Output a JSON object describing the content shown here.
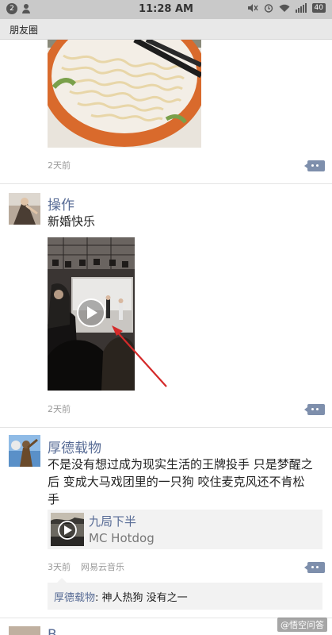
{
  "status_bar": {
    "notif_count": "2",
    "time": "11:28 AM",
    "battery": "40"
  },
  "header": {
    "title": "朋友圈"
  },
  "posts": [
    {
      "timestamp": "2天前"
    },
    {
      "name": "操作",
      "text": "新婚快乐",
      "timestamp": "2天前"
    },
    {
      "name": "厚德载物",
      "text_lines": [
        "不是没有想过成为现实生活的王牌投手 只是梦醒之",
        "后 变成大马戏团里的一只狗 咬住麦克风还不肯松",
        "手"
      ],
      "music": {
        "title": "九局下半",
        "artist": "MC Hotdog"
      },
      "timestamp": "3天前",
      "source": "网易云音乐",
      "comment": {
        "author": "厚德载物",
        "separator": ": ",
        "text": "神人热狗 没有之一"
      }
    },
    {
      "name": "B..."
    }
  ],
  "watermark": "@悟空问答"
}
